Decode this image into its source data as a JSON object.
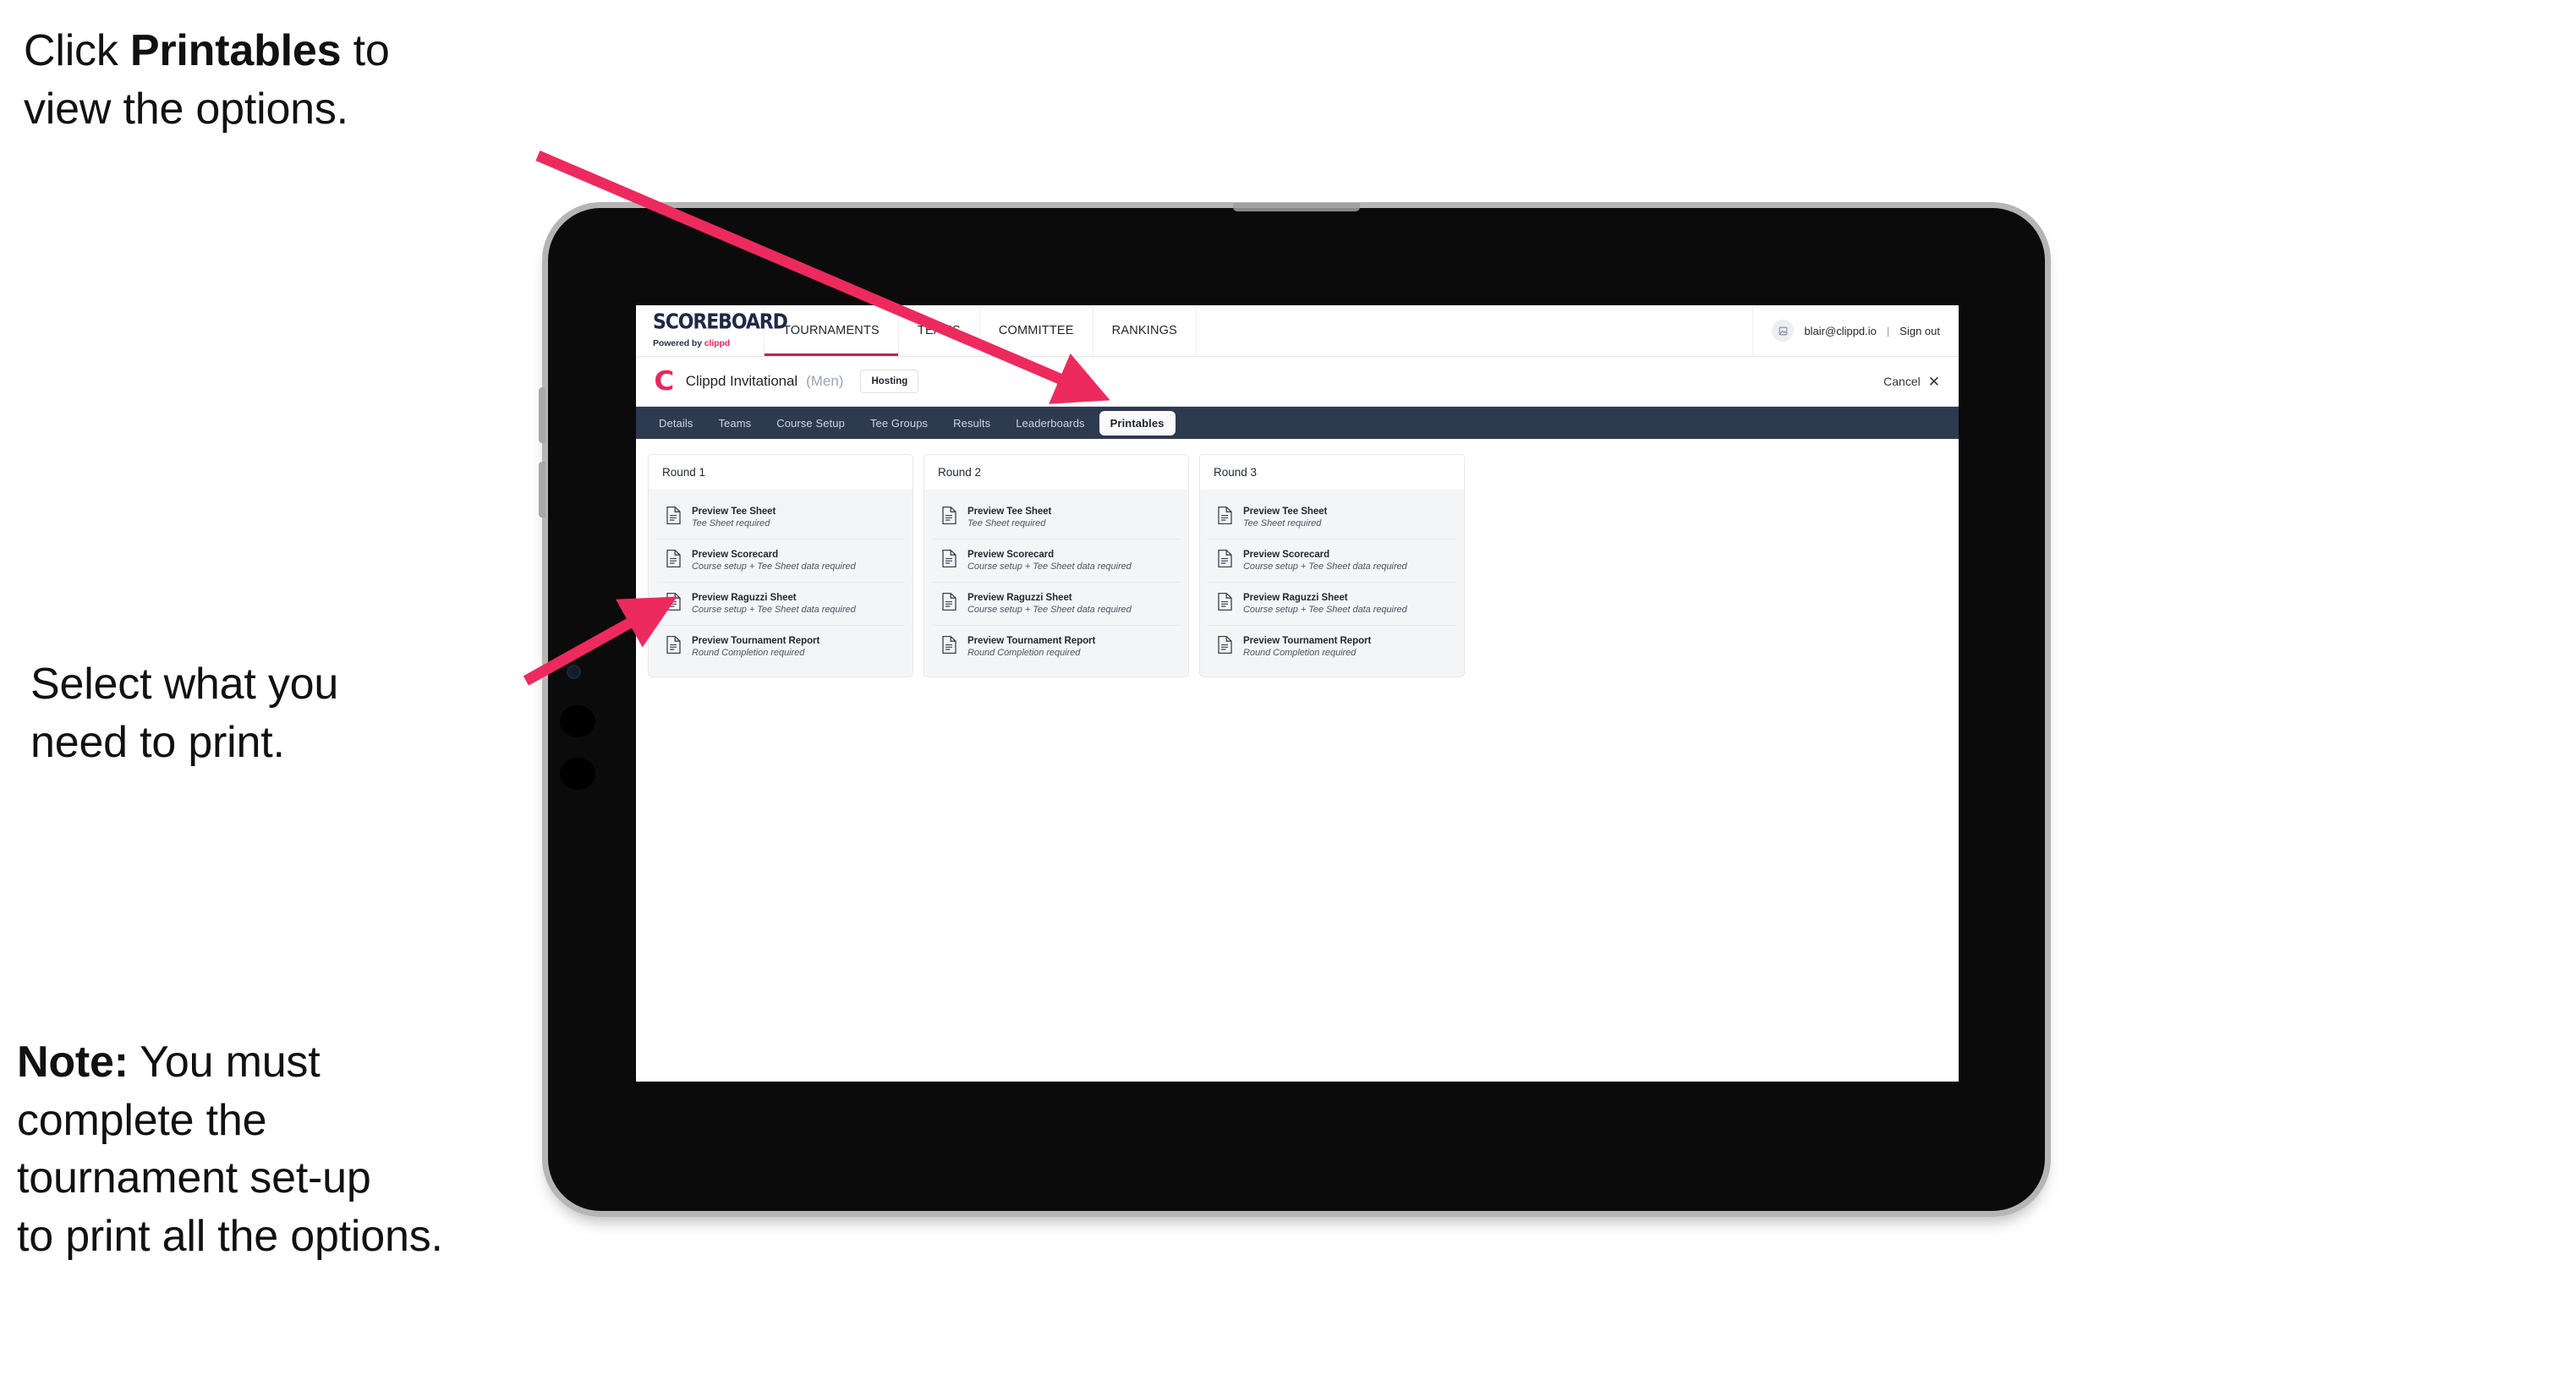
{
  "annotations": {
    "callout_1": {
      "prefix": "Click ",
      "bold": "Printables",
      "suffix": " to\nview the options."
    },
    "callout_2": {
      "text": "Select what you\n need to print."
    },
    "callout_3": {
      "bold": "Note:",
      "text": " You must\ncomplete the\ntournament set-up\nto print all the options."
    }
  },
  "colors": {
    "accent_pink": "#ED2A5E",
    "brand_crimson": "#E8285C",
    "subnav_navy": "#2E3A50",
    "tab_underline": "#B02A4A"
  },
  "app": {
    "topnav": {
      "brand": {
        "title": "SCOREBOARD",
        "powered_prefix": "Powered by ",
        "powered_brand": "clippd"
      },
      "items": [
        {
          "label": "TOURNAMENTS",
          "active": true
        },
        {
          "label": "TEAMS",
          "active": false
        },
        {
          "label": "COMMITTEE",
          "active": false
        },
        {
          "label": "RANKINGS",
          "active": false
        }
      ],
      "user": {
        "avatar_icon": "user-avatar-icon",
        "email": "blair@clippd.io",
        "separator": "|",
        "sign_out": "Sign out"
      }
    },
    "tournament_bar": {
      "logo_letter": "C",
      "name": "Clippd Invitational",
      "gender": "(Men)",
      "badge": "Hosting",
      "cancel_label": "Cancel",
      "cancel_icon": "close-icon"
    },
    "subnav": {
      "items": [
        {
          "label": "Details",
          "active": false
        },
        {
          "label": "Teams",
          "active": false
        },
        {
          "label": "Course Setup",
          "active": false
        },
        {
          "label": "Tee Groups",
          "active": false
        },
        {
          "label": "Results",
          "active": false
        },
        {
          "label": "Leaderboards",
          "active": false
        },
        {
          "label": "Printables",
          "active": true
        }
      ]
    },
    "rounds": [
      {
        "title": "Round 1",
        "items": [
          {
            "title": "Preview Tee Sheet",
            "sub": "Tee Sheet required"
          },
          {
            "title": "Preview Scorecard",
            "sub": "Course setup + Tee Sheet data required"
          },
          {
            "title": "Preview Raguzzi Sheet",
            "sub": "Course setup + Tee Sheet data required"
          },
          {
            "title": "Preview Tournament Report",
            "sub": "Round Completion required"
          }
        ]
      },
      {
        "title": "Round 2",
        "items": [
          {
            "title": "Preview Tee Sheet",
            "sub": "Tee Sheet required"
          },
          {
            "title": "Preview Scorecard",
            "sub": "Course setup + Tee Sheet data required"
          },
          {
            "title": "Preview Raguzzi Sheet",
            "sub": "Course setup + Tee Sheet data required"
          },
          {
            "title": "Preview Tournament Report",
            "sub": "Round Completion required"
          }
        ]
      },
      {
        "title": "Round 3",
        "items": [
          {
            "title": "Preview Tee Sheet",
            "sub": "Tee Sheet required"
          },
          {
            "title": "Preview Scorecard",
            "sub": "Course setup + Tee Sheet data required"
          },
          {
            "title": "Preview Raguzzi Sheet",
            "sub": "Course setup + Tee Sheet data required"
          },
          {
            "title": "Preview Tournament Report",
            "sub": "Round Completion required"
          }
        ]
      }
    ]
  }
}
